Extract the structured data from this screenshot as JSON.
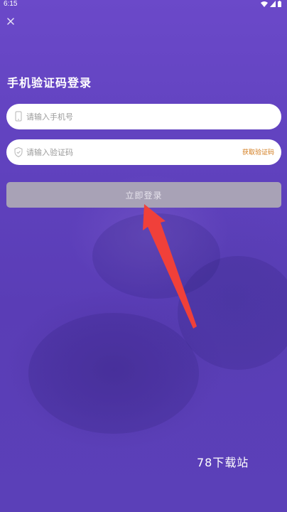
{
  "status_bar": {
    "time": "6:15"
  },
  "login": {
    "title": "手机验证码登录",
    "phone_placeholder": "请输入手机号",
    "code_placeholder": "请输入验证码",
    "get_code_label": "获取验证码",
    "submit_label": "立即登录"
  },
  "watermark": "78下载站",
  "colors": {
    "background": "#5b3fb6",
    "get_code": "#d27a1a",
    "submit_disabled": "#a8a2b6",
    "arrow": "#f0403a"
  },
  "icons": {
    "close": "close-icon",
    "phone": "phone-icon",
    "shield": "shield-icon",
    "wifi": "wifi-icon",
    "signal": "signal-icon",
    "battery": "battery-icon"
  }
}
